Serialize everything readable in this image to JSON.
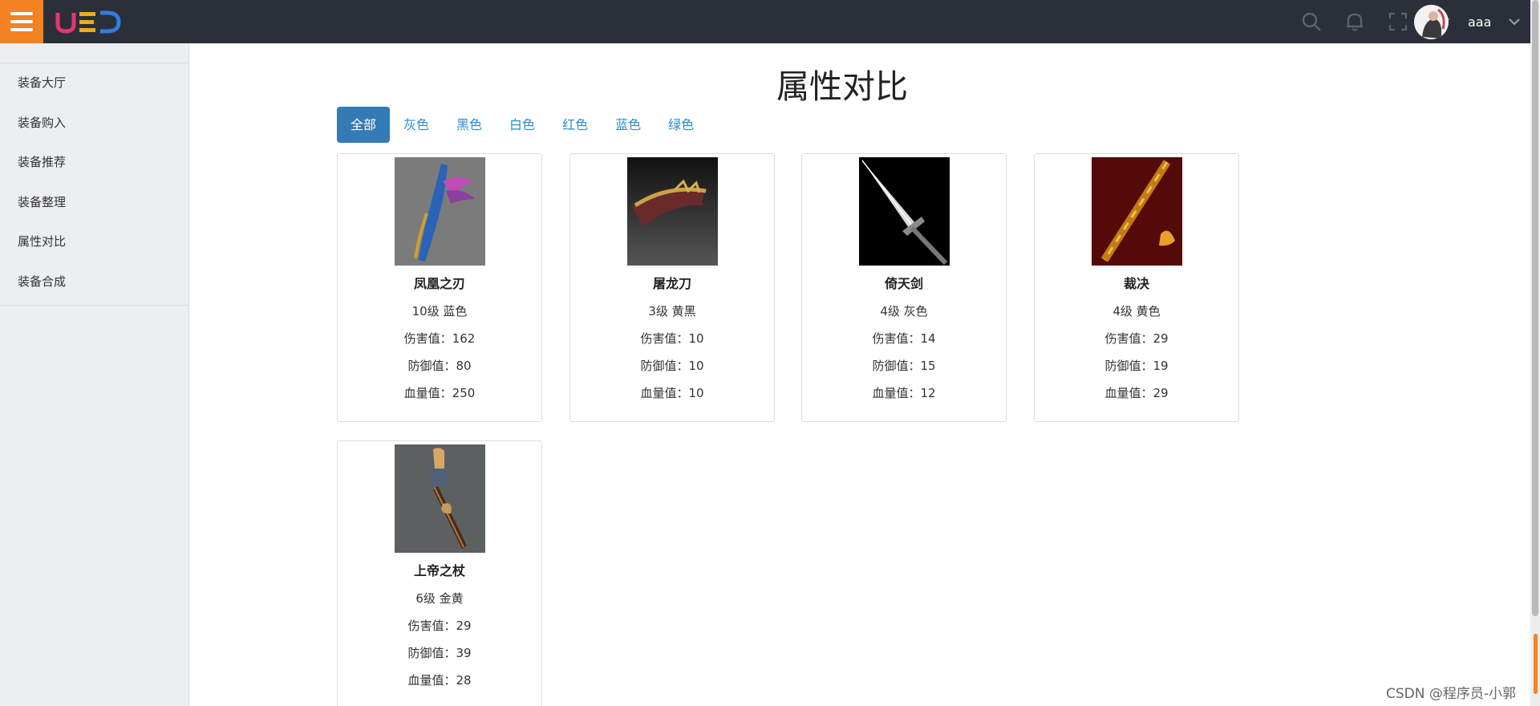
{
  "header": {
    "username": "aaa",
    "icons": [
      "search-icon",
      "bell-icon",
      "fullscreen-icon",
      "star-icon"
    ]
  },
  "sidebar": {
    "items": [
      {
        "label": "装备大厅"
      },
      {
        "label": "装备购入"
      },
      {
        "label": "装备推荐"
      },
      {
        "label": "装备整理"
      },
      {
        "label": "属性对比"
      },
      {
        "label": "装备合成"
      }
    ]
  },
  "main": {
    "title": "属性对比",
    "filters": [
      {
        "label": "全部",
        "active": true
      },
      {
        "label": "灰色"
      },
      {
        "label": "黑色"
      },
      {
        "label": "白色"
      },
      {
        "label": "红色"
      },
      {
        "label": "蓝色"
      },
      {
        "label": "绿色"
      }
    ],
    "cards": [
      {
        "name": "凤凰之刃",
        "level": "10级 蓝色",
        "damage": "伤害值：162",
        "defense": "防御值：80",
        "hp": "血量值：250"
      },
      {
        "name": "屠龙刀",
        "level": "3级 黄黑",
        "damage": "伤害值：10",
        "defense": "防御值：10",
        "hp": "血量值：10"
      },
      {
        "name": "倚天剑",
        "level": "4级 灰色",
        "damage": "伤害值：14",
        "defense": "防御值：15",
        "hp": "血量值：12"
      },
      {
        "name": "裁决",
        "level": "4级 黄色",
        "damage": "伤害值：29",
        "defense": "防御值：19",
        "hp": "血量值：29"
      },
      {
        "name": "上帝之杖",
        "level": "6级 金黄",
        "damage": "伤害值：29",
        "defense": "防御值：39",
        "hp": "血量值：28"
      }
    ]
  },
  "watermark": "CSDN @程序员-小郭",
  "colors": {
    "topbar": "#2b2f3a",
    "accent": "#f58220",
    "active_filter": "#337ab7",
    "link": "#2a8ccf"
  }
}
